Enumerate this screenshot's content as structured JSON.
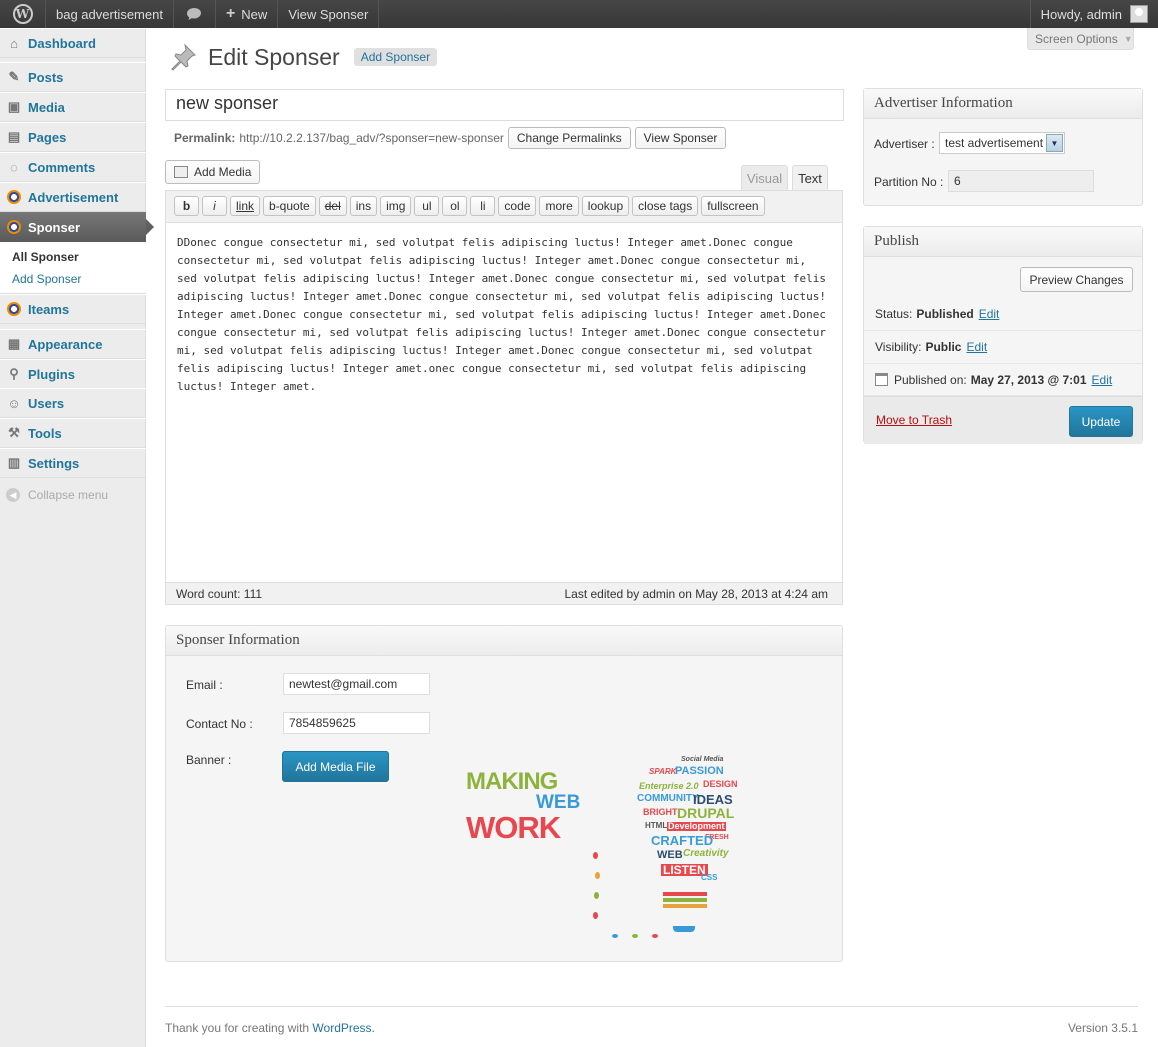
{
  "adminbar": {
    "site_name": "bag advertisement",
    "new_label": "New",
    "view_label": "View Sponser",
    "howdy": "Howdy, admin"
  },
  "screen_options": "Screen Options",
  "sidebar": {
    "items": [
      {
        "label": "Dashboard",
        "icon": "dashboard-icon"
      },
      {
        "label": "Posts",
        "icon": "pin-icon"
      },
      {
        "label": "Media",
        "icon": "media-icon"
      },
      {
        "label": "Pages",
        "icon": "pages-icon"
      },
      {
        "label": "Comments",
        "icon": "comments-icon"
      },
      {
        "label": "Advertisement",
        "icon": "custom-post-icon"
      },
      {
        "label": "Sponser",
        "icon": "custom-post-icon"
      },
      {
        "label": "Iteams",
        "icon": "custom-post-icon"
      },
      {
        "label": "Appearance",
        "icon": "appearance-icon"
      },
      {
        "label": "Plugins",
        "icon": "plugins-icon"
      },
      {
        "label": "Users",
        "icon": "users-icon"
      },
      {
        "label": "Tools",
        "icon": "tools-icon"
      },
      {
        "label": "Settings",
        "icon": "settings-icon"
      }
    ],
    "submenu": [
      "All Sponser",
      "Add Sponser"
    ],
    "collapse": "Collapse menu"
  },
  "page": {
    "title": "Edit Sponser",
    "add_new": "Add Sponser",
    "post_title": "new sponser",
    "permalink_label": "Permalink:",
    "permalink_url": "http://10.2.2.137/bag_adv/?sponser=new-sponser",
    "change_permalinks": "Change Permalinks",
    "view_post": "View Sponser"
  },
  "editor": {
    "add_media": "Add Media",
    "tab_visual": "Visual",
    "tab_text": "Text",
    "quicktags": [
      "b",
      "i",
      "link",
      "b-quote",
      "del",
      "ins",
      "img",
      "ul",
      "ol",
      "li",
      "code",
      "more",
      "lookup",
      "close tags",
      "fullscreen"
    ],
    "content": "DDonec congue consectetur mi, sed volutpat felis adipiscing luctus! Integer amet.Donec congue consectetur mi, sed volutpat felis adipiscing luctus! Integer amet.Donec congue consectetur mi, sed volutpat felis adipiscing luctus! Integer amet.Donec congue consectetur mi, sed volutpat felis adipiscing luctus! Integer amet.Donec congue consectetur mi, sed volutpat felis adipiscing luctus! Integer amet.Donec congue consectetur mi, sed volutpat felis adipiscing luctus! Integer amet.Donec congue consectetur mi, sed volutpat felis adipiscing luctus! Integer amet.Donec congue consectetur mi, sed volutpat felis adipiscing luctus! Integer amet.Donec congue consectetur mi, sed volutpat felis adipiscing luctus! Integer amet.onec congue consectetur mi, sed volutpat felis adipiscing luctus! Integer amet.",
    "word_count": "Word count: 111",
    "last_edited": "Last edited by admin on May 28, 2013 at 4:24 am"
  },
  "sponser_info": {
    "title": "Sponser Information",
    "email_label": "Email :",
    "email_value": "newtest@gmail.com",
    "contact_label": "Contact No :",
    "contact_value": "7854859625",
    "banner_label": "Banner :",
    "add_media_file": "Add Media File",
    "banner": {
      "line1": "MAKING",
      "line2": "WEB",
      "line3": "WORK",
      "cloud": [
        "Social Media",
        "PASSION",
        "SPARK",
        "DESIGN",
        "Enterprise 2.0",
        "COMMUNITY",
        "IDEAS",
        "BRIGHT",
        "DRUPAL",
        "HTML5",
        "Development",
        "FRESH",
        "CRAFTED",
        "WEB",
        "Creativity",
        "LISTEN",
        "CSS"
      ]
    }
  },
  "advertiser_info": {
    "title": "Advertiser Information",
    "advertiser_label": "Advertiser :",
    "advertiser_value": "test advertisement",
    "partition_label": "Partition No :",
    "partition_value": "6"
  },
  "publish": {
    "title": "Publish",
    "preview": "Preview Changes",
    "status_label": "Status:",
    "status_value": "Published",
    "visibility_label": "Visibility:",
    "visibility_value": "Public",
    "published_label": "Published on:",
    "published_value": "May 27, 2013 @ 7:01",
    "edit": "Edit",
    "trash": "Move to Trash",
    "update": "Update"
  },
  "footer": {
    "thanks": "Thank you for creating with",
    "wp_link": "WordPress.",
    "version": "Version 3.5.1"
  }
}
